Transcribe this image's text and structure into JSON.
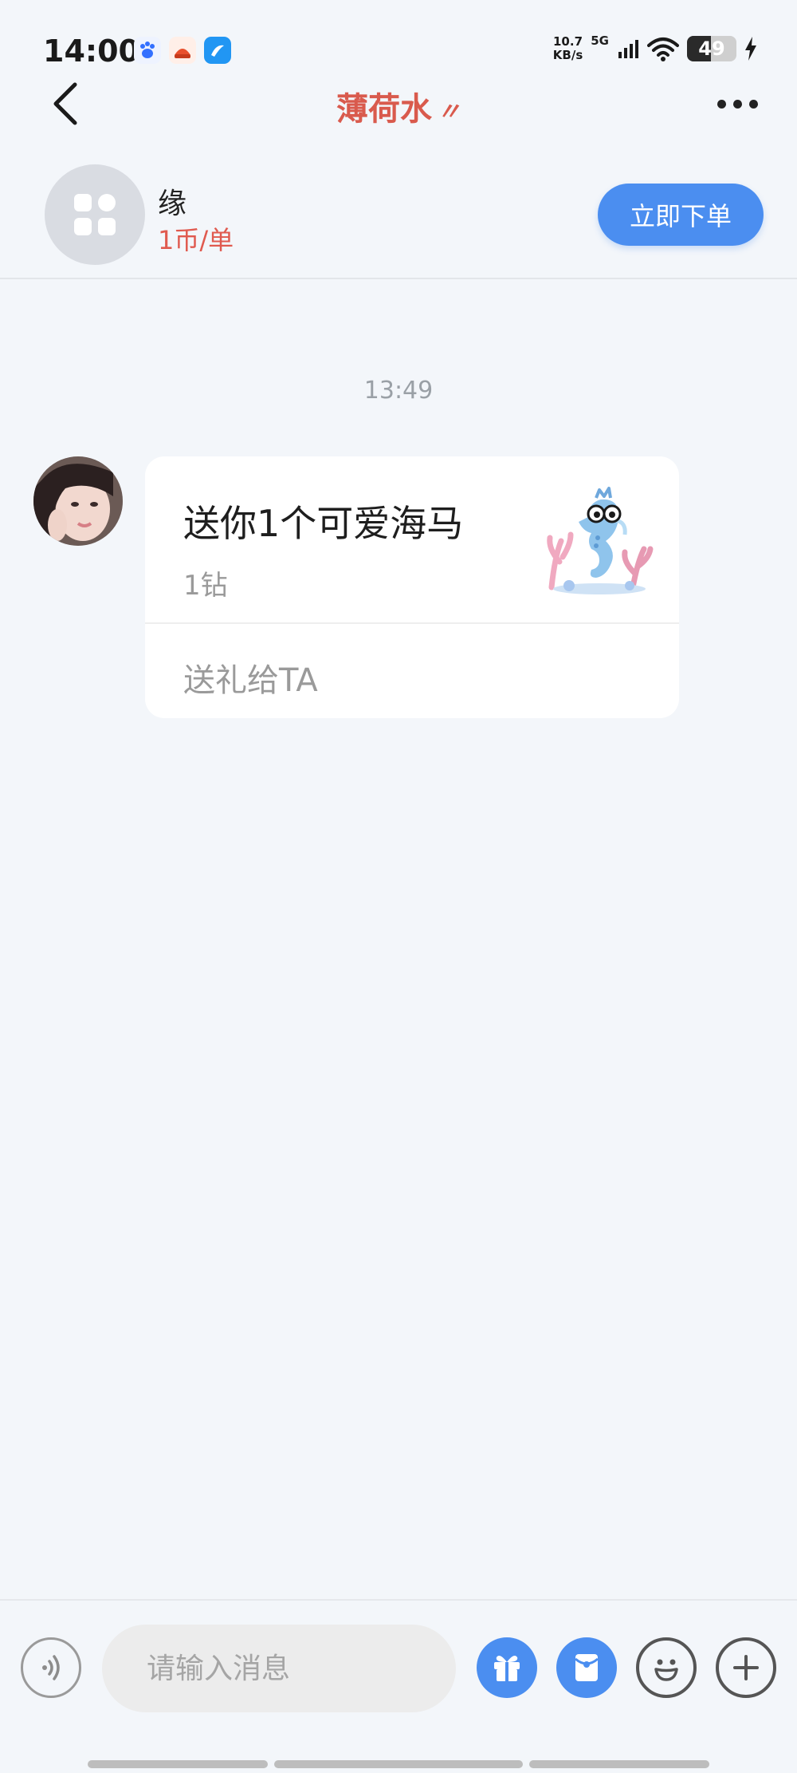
{
  "status": {
    "time": "14:00",
    "net_speed_value": "10.7",
    "net_speed_unit": "KB/s",
    "network": "5G",
    "battery": "49",
    "battery_level": 0.49
  },
  "header": {
    "title": "薄荷水",
    "title_deco": "〃"
  },
  "order": {
    "service_name": "缘",
    "price": "1币/单",
    "order_button": "立即下单"
  },
  "chat": {
    "timestamp": "13:49",
    "gift_message": {
      "title": "送你1个可爱海马",
      "price": "1钻",
      "action": "送礼给TA"
    }
  },
  "input": {
    "placeholder": "请输入消息"
  },
  "colors": {
    "accent": "#4b8ef0",
    "title_red": "#d95a4d",
    "background": "#f3f6fa"
  }
}
